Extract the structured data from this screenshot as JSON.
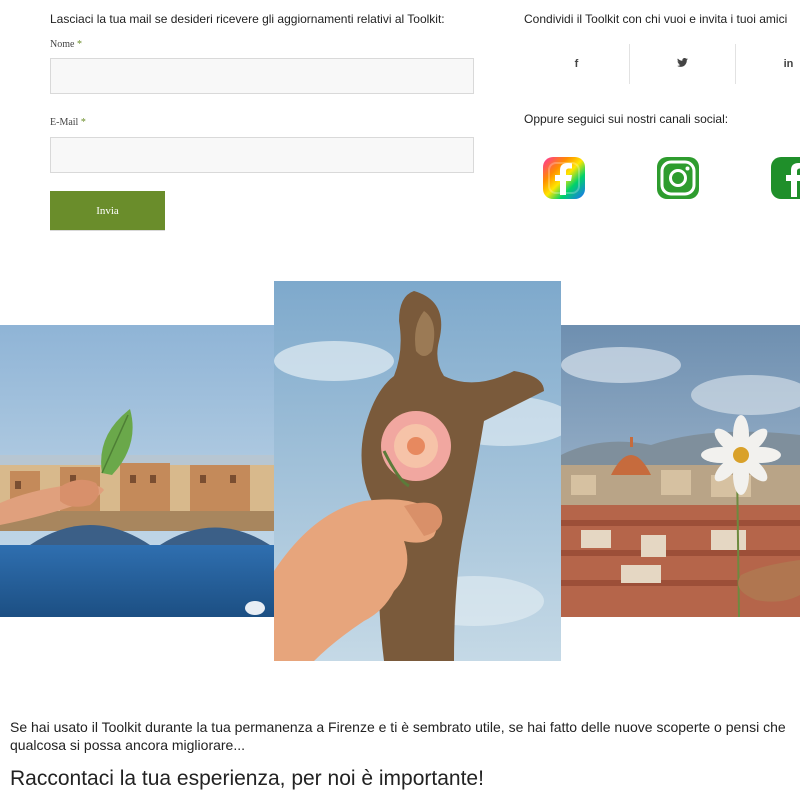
{
  "newsletter": {
    "intro": "Lasciaci la tua mail se desideri ricevere gli aggiornamenti relativi al Toolkit:",
    "name_label": "Nome",
    "email_label": "E-Mail",
    "required_mark": "*",
    "name_value": "",
    "email_value": "",
    "submit_label": "Invia"
  },
  "share": {
    "text": "Condividi il Toolkit con chi vuoi e invita i tuoi amici",
    "buttons": [
      {
        "label": "f",
        "icon": "facebook-icon"
      },
      {
        "label": "🐦",
        "icon": "twitter-icon"
      },
      {
        "label": "in",
        "icon": "linkedin-icon"
      }
    ]
  },
  "follow": {
    "text": "Oppure seguici sui nostri canali social:",
    "icons": [
      "facebook-gradient-icon",
      "instagram-icon",
      "facebook-green-icon"
    ]
  },
  "gallery": {
    "images": [
      "ponte-vecchio-leaf-photo",
      "statue-rose-photo",
      "florence-duomo-flower-photo"
    ]
  },
  "bottom": {
    "paragraph": "Se hai usato il Toolkit durante la tua permanenza a Firenze e ti è sembrato utile, se hai fatto delle nuove scoperte o pensi che qualcosa si possa ancora migliorare...",
    "heading": "Raccontaci la tua esperienza, per noi è importante!"
  },
  "colors": {
    "accent_green": "#6a8d2b",
    "instagram_green": "#2e9c2e",
    "facebook_green": "#1f8f2a"
  }
}
